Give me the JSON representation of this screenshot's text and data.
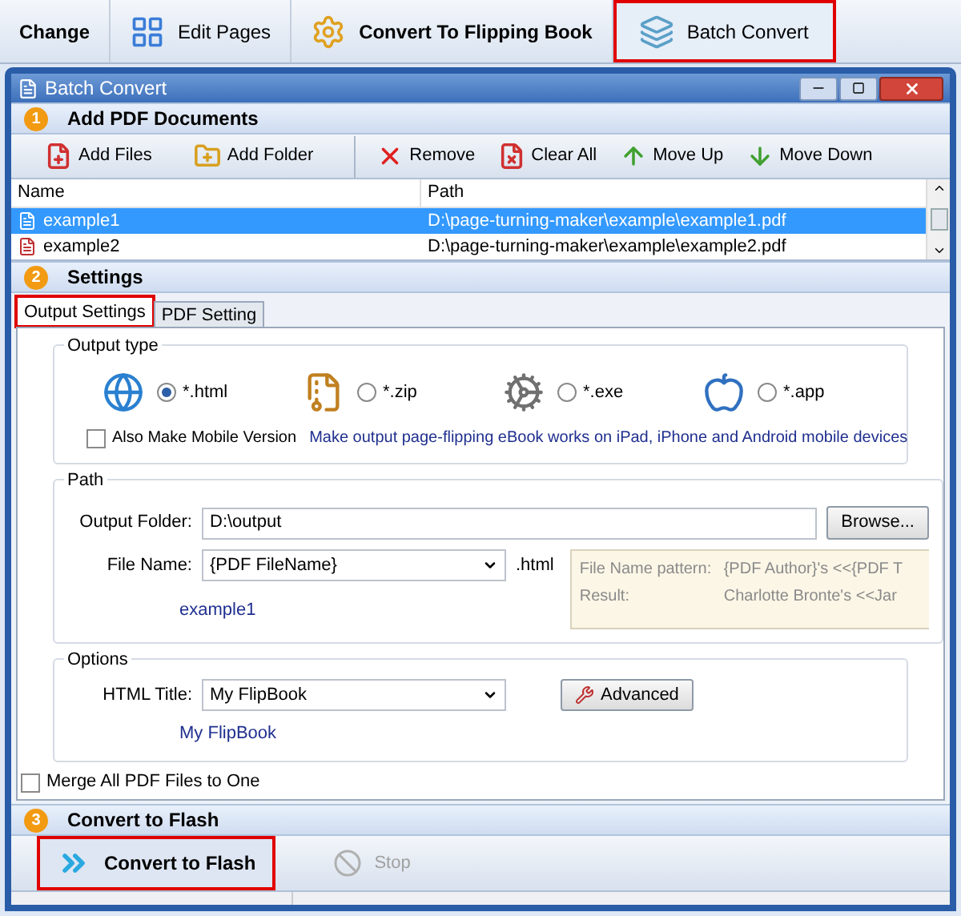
{
  "app_toolbar": [
    {
      "label": "Change",
      "bold": true,
      "selected": false,
      "highlighted": false
    },
    {
      "label": "Edit Pages",
      "bold": false,
      "selected": false,
      "highlighted": false
    },
    {
      "label": "Convert To Flipping Book",
      "bold": true,
      "selected": false,
      "highlighted": false
    },
    {
      "label": "Batch Convert",
      "bold": false,
      "selected": true,
      "highlighted": true
    }
  ],
  "window": {
    "title": "Batch Convert"
  },
  "add_section": {
    "number": "1",
    "title": "Add PDF Documents",
    "tools": [
      {
        "label": "Add Files"
      },
      {
        "label": "Add Folder"
      },
      {
        "label": "Remove"
      },
      {
        "label": "Clear All"
      },
      {
        "label": "Move Up"
      },
      {
        "label": "Move Down"
      }
    ],
    "table": {
      "columns": [
        "Name",
        "Path"
      ],
      "rows": [
        {
          "name": "example1",
          "path": "D:\\page-turning-maker\\example\\example1.pdf",
          "selected": true
        },
        {
          "name": "example2",
          "path": "D:\\page-turning-maker\\example\\example2.pdf",
          "selected": false
        }
      ]
    }
  },
  "settings_section": {
    "number": "2",
    "title": "Settings",
    "tabs": [
      {
        "label": "Output Settings",
        "selected": true,
        "highlighted": true
      },
      {
        "label": "PDF Setting",
        "selected": false,
        "highlighted": false
      }
    ],
    "output_type": {
      "title": "Output type",
      "options": [
        {
          "label": "*.html",
          "selected": true
        },
        {
          "label": "*.zip",
          "selected": false
        },
        {
          "label": "*.exe",
          "selected": false
        },
        {
          "label": "*.app",
          "selected": false
        }
      ],
      "mobile": {
        "label": "Also Make Mobile Version",
        "checked": false
      },
      "note": "Make output page-flipping eBook works on iPad, iPhone and Android mobile devices"
    },
    "path": {
      "title": "Path",
      "output_folder": {
        "label": "Output Folder:",
        "value": "D:\\output"
      },
      "browse": "Browse...",
      "file_name": {
        "label": "File Name:",
        "value": "{PDF FileName}",
        "suffix": ".html",
        "preview": "example1"
      },
      "pattern": [
        {
          "label": "File Name pattern:",
          "value": "{PDF Author}'s <<{PDF T"
        },
        {
          "label": "Result:",
          "value": "Charlotte Bronte's <<Jar"
        }
      ]
    },
    "options": {
      "title": "Options",
      "html_title": {
        "label": "HTML Title:",
        "value": "My FlipBook",
        "preview": "My FlipBook"
      },
      "advanced": "Advanced"
    },
    "merge": {
      "label": "Merge All PDF Files to One",
      "checked": false
    }
  },
  "convert_section": {
    "number": "3",
    "title": "Convert to Flash",
    "buttons": [
      {
        "label": "Convert to Flash",
        "disabled": false,
        "highlighted": true
      },
      {
        "label": "Stop",
        "disabled": true,
        "highlighted": false
      }
    ]
  }
}
